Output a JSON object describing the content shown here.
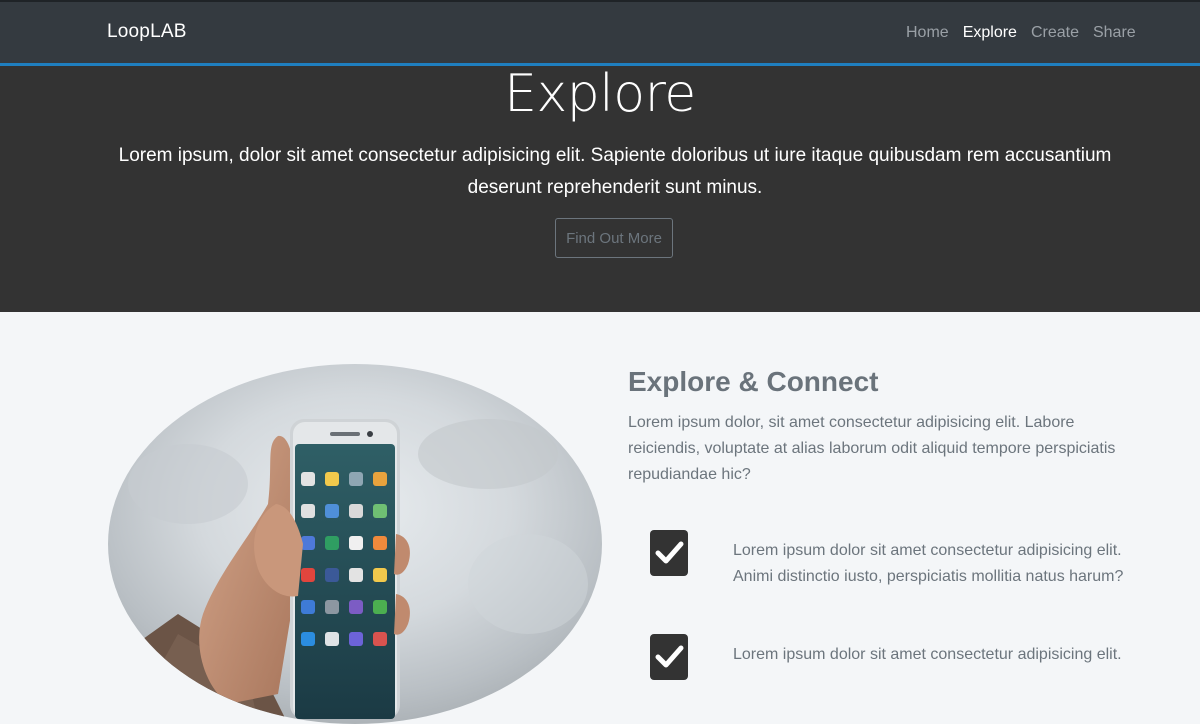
{
  "navbar": {
    "brand": "LoopLAB",
    "links": [
      {
        "label": "Home",
        "active": false
      },
      {
        "label": "Explore",
        "active": true
      },
      {
        "label": "Create",
        "active": false
      },
      {
        "label": "Share",
        "active": false
      }
    ]
  },
  "hero": {
    "title": "Explore",
    "text": "Lorem ipsum, dolor sit amet consectetur adipisicing elit. Sapiente doloribus ut iure itaque quibusdam rem accusantium deserunt reprehenderit sunt minus.",
    "button": "Find Out More"
  },
  "section": {
    "title": "Explore & Connect",
    "text": "Lorem ipsum dolor, sit amet consectetur adipisicing elit. Labore reiciendis, voluptate at alias laborum odit aliquid tempore perspiciatis repudiandae hic?",
    "features": [
      {
        "text": "Lorem ipsum dolor sit amet consectetur adipisicing elit. Animi distinctio iusto, perspiciatis mollitia natus harum?",
        "icon": "check-icon"
      },
      {
        "text": "Lorem ipsum dolor sit amet consectetur adipisicing elit.",
        "icon": "check-icon"
      }
    ]
  },
  "colors": {
    "navbar": "#343a40",
    "hero": "#333333",
    "accent_rule": "#1f7fc0",
    "page_bg": "#f4f6f8",
    "muted_text": "#6c757d"
  },
  "image": {
    "icon": "phone-in-hand-photo"
  }
}
